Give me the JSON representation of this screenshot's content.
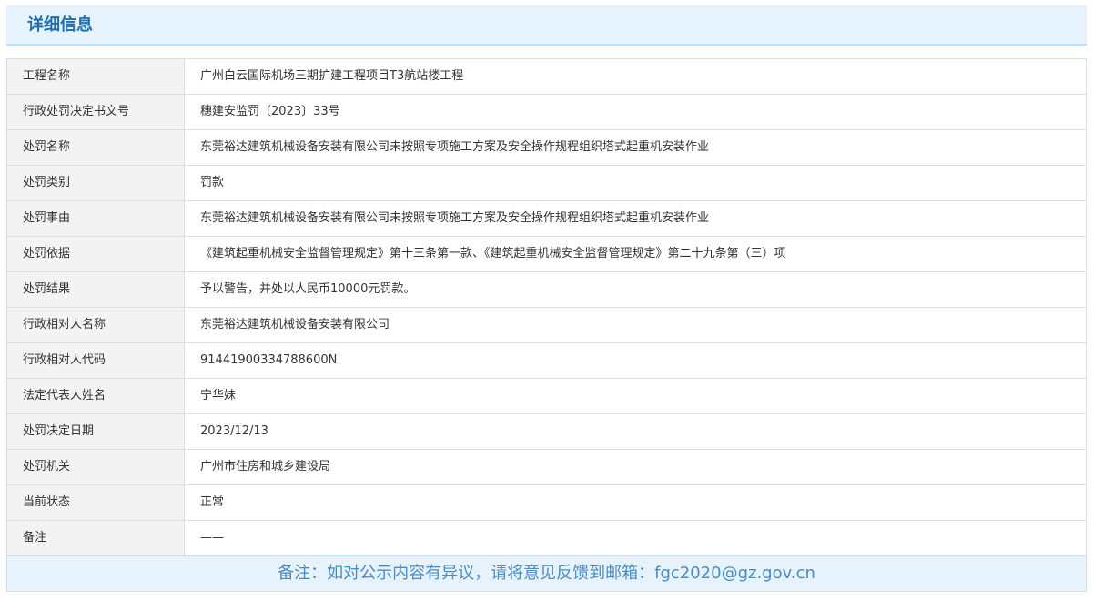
{
  "header": {
    "title": "详细信息"
  },
  "rows": [
    {
      "label": "工程名称",
      "value": "广州白云国际机场三期扩建工程项目T3航站楼工程"
    },
    {
      "label": "行政处罚决定书文号",
      "value": "穗建安监罚〔2023〕33号"
    },
    {
      "label": "处罚名称",
      "value": "东莞裕达建筑机械设备安装有限公司未按照专项施工方案及安全操作规程组织塔式起重机安装作业"
    },
    {
      "label": "处罚类别",
      "value": "罚款"
    },
    {
      "label": "处罚事由",
      "value": "东莞裕达建筑机械设备安装有限公司未按照专项施工方案及安全操作规程组织塔式起重机安装作业"
    },
    {
      "label": "处罚依据",
      "value": "《建筑起重机械安全监督管理规定》第十三条第一款、《建筑起重机械安全监督管理规定》第二十九条第（三）项"
    },
    {
      "label": "处罚结果",
      "value": "予以警告，并处以人民币10000元罚款。"
    },
    {
      "label": "行政相对人名称",
      "value": "东莞裕达建筑机械设备安装有限公司"
    },
    {
      "label": "行政相对人代码",
      "value": "91441900334788600N"
    },
    {
      "label": "法定代表人姓名",
      "value": "宁华妹"
    },
    {
      "label": "处罚决定日期",
      "value": "2023/12/13"
    },
    {
      "label": "处罚机关",
      "value": "广州市住房和城乡建设局"
    },
    {
      "label": "当前状态",
      "value": "正常"
    },
    {
      "label": "备注",
      "value": "——"
    }
  ],
  "footer": {
    "note": "备注：如对公示内容有异议，请将意见反馈到邮箱：fgc2020@gz.gov.cn"
  }
}
